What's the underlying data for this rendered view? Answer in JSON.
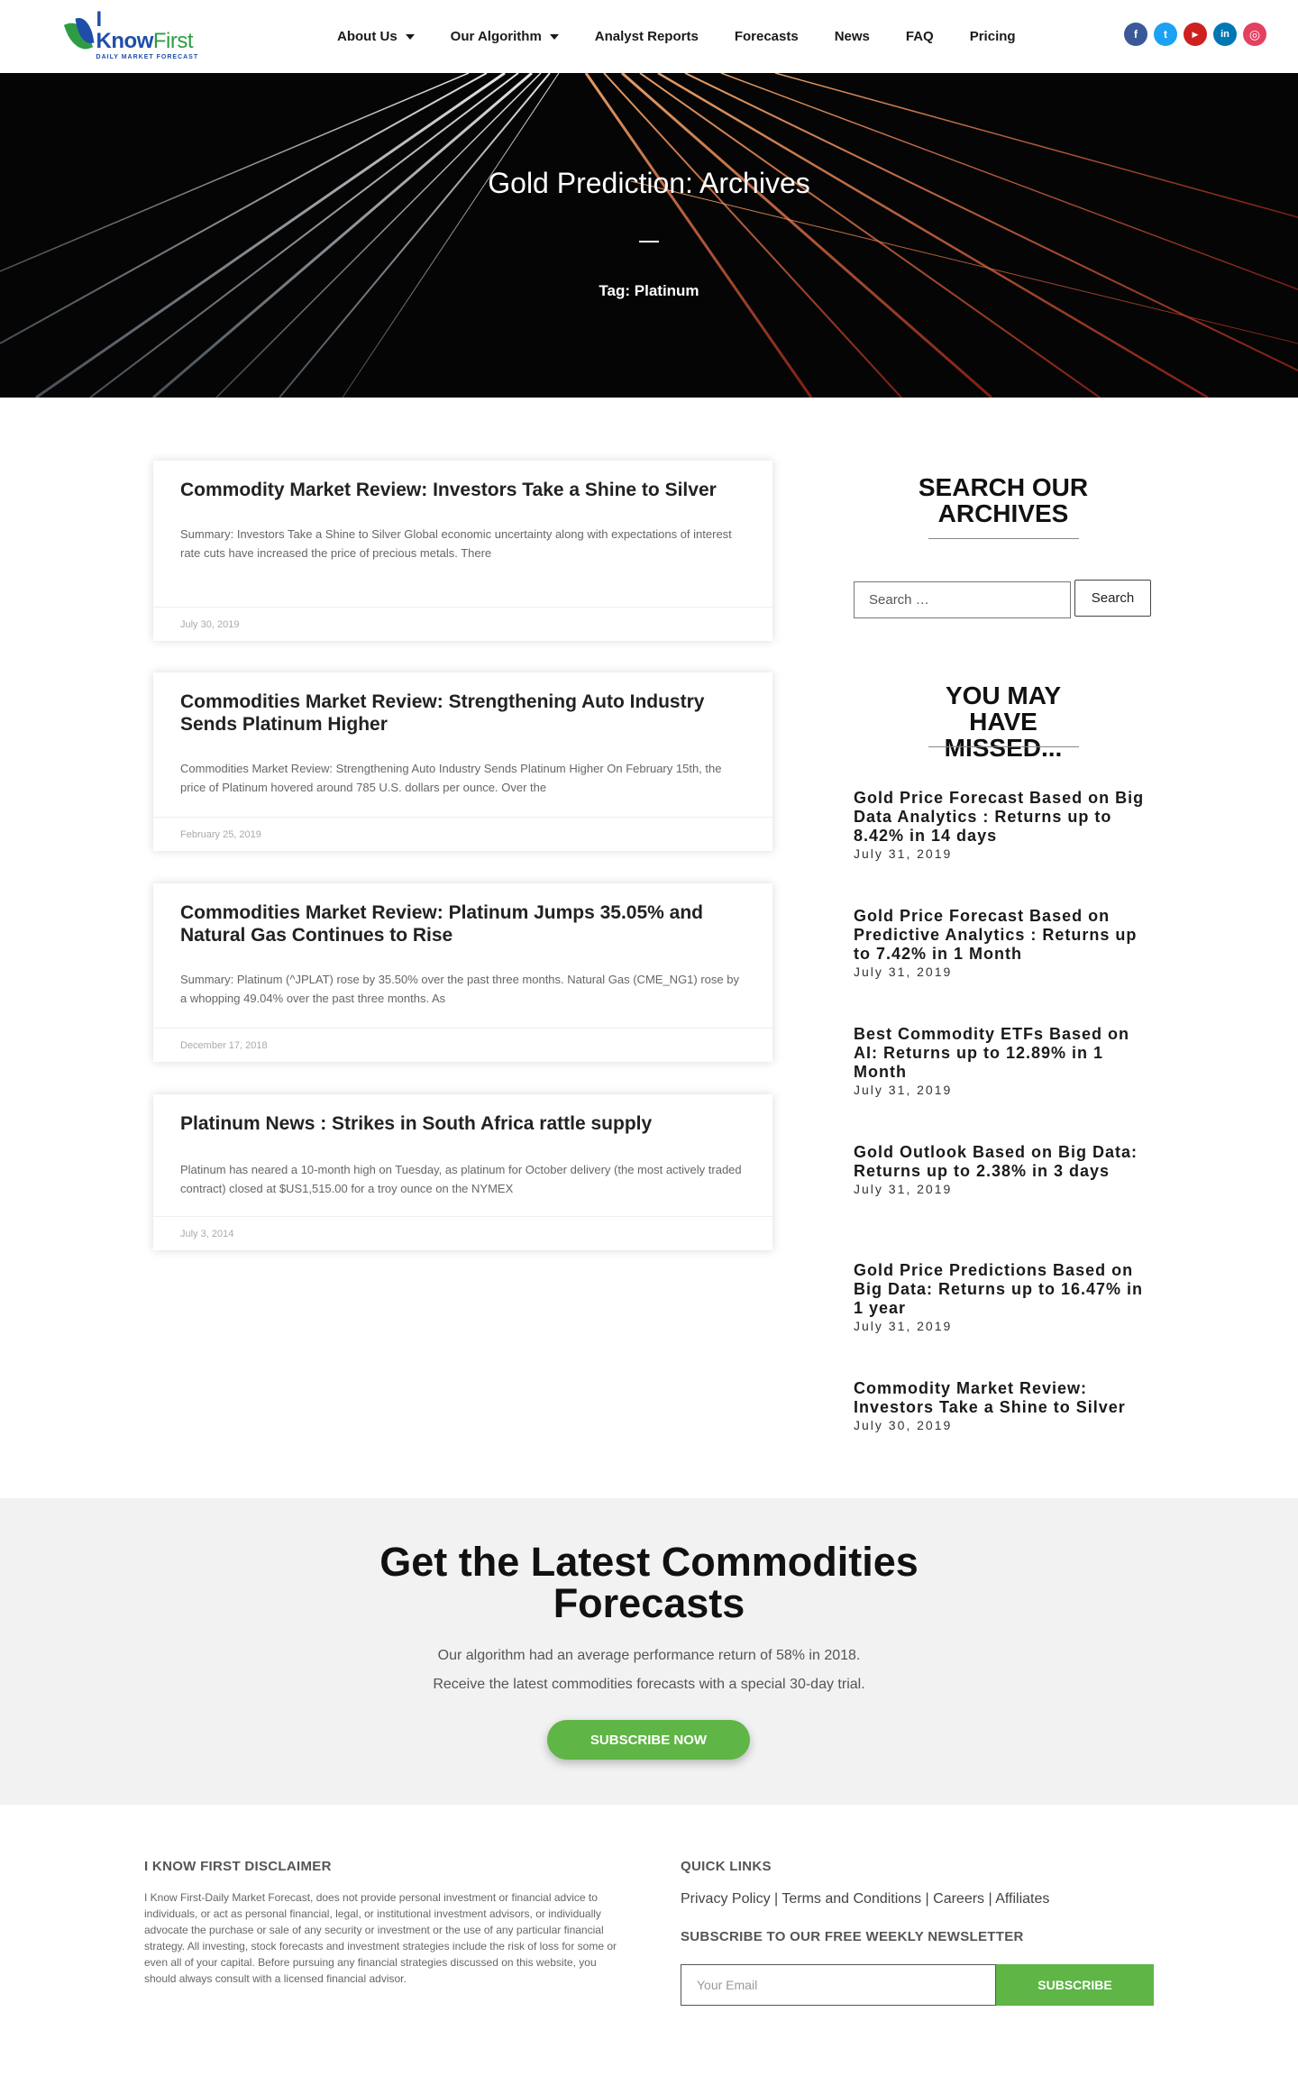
{
  "logo": {
    "title_part1": "I Know",
    "title_part2": "First",
    "subtitle": "DAILY MARKET FORECAST"
  },
  "nav": {
    "items": [
      {
        "label": "About Us",
        "has_dropdown": true
      },
      {
        "label": "Our Algorithm",
        "has_dropdown": true
      },
      {
        "label": "Analyst Reports",
        "has_dropdown": false
      },
      {
        "label": "Forecasts",
        "has_dropdown": false
      },
      {
        "label": "News",
        "has_dropdown": false
      },
      {
        "label": "FAQ",
        "has_dropdown": false
      },
      {
        "label": "Pricing",
        "has_dropdown": false
      }
    ]
  },
  "socials": [
    {
      "icon": "facebook-icon",
      "glyph": "f",
      "color": "#3b5998"
    },
    {
      "icon": "twitter-icon",
      "glyph": "t",
      "color": "#1da1f2"
    },
    {
      "icon": "youtube-icon",
      "glyph": "▶",
      "color": "#cd201f"
    },
    {
      "icon": "linkedin-icon",
      "glyph": "in",
      "color": "#0077b5"
    },
    {
      "icon": "instagram-icon",
      "glyph": "◎",
      "color": "#e4405f"
    }
  ],
  "hero": {
    "title": "Gold Prediction: Archives",
    "tag": "Tag: Platinum"
  },
  "posts": [
    {
      "title": "Commodity Market Review: Investors Take a Shine to Silver",
      "excerpt": "Summary: Investors Take a Shine to Silver Global economic uncertainty along with expectations of interest rate cuts have increased the price of precious metals. There",
      "date": "July 30, 2019"
    },
    {
      "title": "Commodities Market Review: Strengthening Auto Industry Sends Platinum Higher",
      "excerpt": "Commodities Market Review: Strengthening Auto Industry Sends Platinum Higher On February 15th, the price of Platinum hovered around 785 U.S. dollars per ounce. Over the",
      "date": "February 25, 2019"
    },
    {
      "title": "Commodities Market Review: Platinum Jumps 35.05% and Natural Gas Continues to Rise",
      "excerpt": "Summary: Platinum (^JPLAT) rose by 35.50% over the past three months. Natural Gas (CME_NG1) rose by a whopping 49.04% over the past three months. As",
      "date": "December 17, 2018"
    },
    {
      "title": "Platinum News : Strikes in South Africa rattle supply",
      "excerpt": "Platinum has neared a 10-month high on Tuesday, as platinum for October delivery (the most actively traded contract) closed at $US1,515.00 for a troy ounce on the NYMEX",
      "date": "July 3, 2014"
    }
  ],
  "sidebar": {
    "search_heading": "SEARCH OUR ARCHIVES",
    "search_placeholder": "Search …",
    "search_button": "Search",
    "missed_heading": "YOU MAY HAVE MISSED...",
    "missed": [
      {
        "title": "Gold Price Forecast Based on Big Data Analytics : Returns up to 8.42% in 14 days",
        "date": "July 31, 2019"
      },
      {
        "title": "Gold Price Forecast Based on Predictive Analytics : Returns up to 7.42% in 1 Month",
        "date": "July 31, 2019"
      },
      {
        "title": "Best Commodity ETFs Based on AI: Returns up to 12.89% in 1 Month",
        "date": "July 31, 2019"
      },
      {
        "title": "Gold Outlook Based on Big Data: Returns up to 2.38% in 3 days",
        "date": "July 31, 2019"
      },
      {
        "title": "Gold Price Predictions Based on Big Data: Returns up to 16.47% in 1 year",
        "date": "July 31, 2019"
      },
      {
        "title": "Commodity Market Review: Investors Take a Shine to Silver",
        "date": "July 30, 2019"
      }
    ]
  },
  "cta": {
    "title": "Get the Latest Commodities Forecasts",
    "line1": "Our algorithm had an average performance return of 58% in 2018.",
    "line2": "Receive the latest commodities forecasts with a special 30-day trial.",
    "button": "SUBSCRIBE NOW",
    "button_color": "#5fb546"
  },
  "footer": {
    "disclaimer_heading": "I KNOW FIRST DISCLAIMER",
    "disclaimer_text": "I Know First-Daily Market Forecast, does not provide personal investment or financial advice to individuals, or act as personal financial, legal, or institutional investment advisors, or individually advocate the purchase or sale of any security or investment or the use of any particular financial strategy. All investing, stock forecasts and investment strategies include the risk of loss for some or even all of your capital. Before pursuing any financial strategies discussed on this website, you should always consult with a licensed financial advisor.",
    "quick_links_heading": "QUICK LINKS",
    "quick_links": [
      "Privacy Policy",
      "Terms and Conditions",
      "Careers",
      "Affiliates"
    ],
    "newsletter_heading": "SUBSCRIBE TO OUR FREE WEEKLY NEWSLETTER",
    "email_placeholder": "Your Email",
    "subscribe_button": "SUBSCRIBE"
  }
}
